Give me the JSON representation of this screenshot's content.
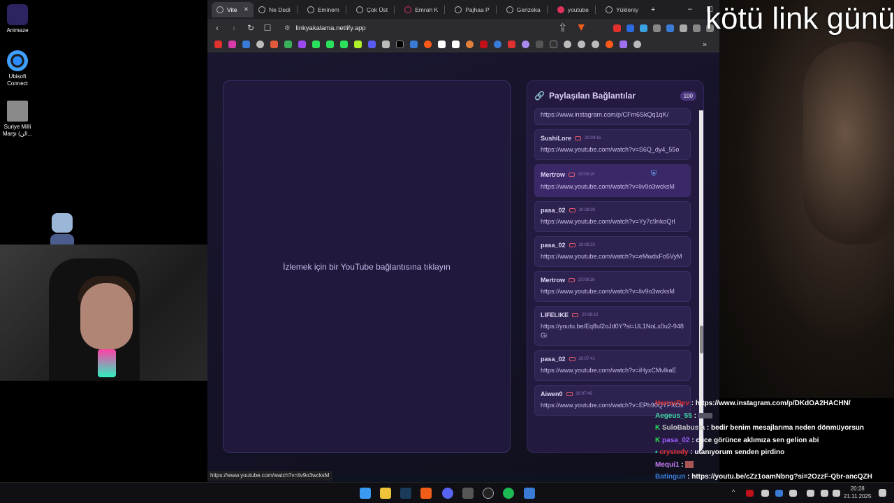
{
  "overlay_title": "kötü link günü",
  "desktop": {
    "icons": [
      {
        "label": "Animaze"
      },
      {
        "label": "Ubisoft Connect"
      },
      {
        "label": "Suriye Milli Marşı (الن..."
      }
    ]
  },
  "browser": {
    "tabs": [
      {
        "label": "Vite",
        "icon": "globe-icon",
        "active": true
      },
      {
        "label": "Ne Dedi",
        "icon": "globe-icon"
      },
      {
        "label": "Eminem",
        "icon": "globe-icon"
      },
      {
        "label": "Çok Üst",
        "icon": "globe-icon"
      },
      {
        "label": "Emrah K",
        "icon": "globe-icon"
      },
      {
        "label": "Pajhaa P",
        "icon": "globe-icon"
      },
      {
        "label": "Gerizeka",
        "icon": "globe-icon"
      },
      {
        "label": "youtube",
        "icon": "globe-icon"
      },
      {
        "label": "Yükleniy",
        "icon": "globe-icon"
      }
    ],
    "url": "linkyakalama.netlify.app",
    "status_url": "https://www.youtube.com/watch?v=liv9o3wcksM"
  },
  "page": {
    "player_placeholder": "İzlemek için bir YouTube bağlantısına tıklayın",
    "panel_title": "Paylaşılan Bağlantılar",
    "panel_count": "100",
    "links": [
      {
        "user": "",
        "time": "",
        "url": "https://www.instagram.com/p/CFm6SkQq1qK/"
      },
      {
        "user": "SushiLore",
        "time": "20:09:16",
        "url": "https://www.youtube.com/watch?v=S6Q_dy4_55o"
      },
      {
        "user": "Mertrow",
        "time": "20:09:10",
        "url": "https://www.youtube.com/watch?v=liv9o3wcksM"
      },
      {
        "user": "pasa_02",
        "time": "20:08:39",
        "url": "https://www.youtube.com/watch?v=Yy7c9nkoQrI"
      },
      {
        "user": "pasa_02",
        "time": "20:08:23",
        "url": "https://www.youtube.com/watch?v=eMwdxFo5VyM"
      },
      {
        "user": "Mertrow",
        "time": "20:08:16",
        "url": "https://www.youtube.com/watch?v=liv9o3wcksM"
      },
      {
        "user": "LIFELIKE",
        "time": "20:08:10",
        "url": "https://youtu.be/Eq8ul2oJd0Y?si=UL1NoLx0u2-948Gi"
      },
      {
        "user": "pasa_02",
        "time": "20:07:41",
        "url": "https://www.youtube.com/watch?v=iHyxCMvlkaE"
      },
      {
        "user": "Aiwen0",
        "time": "20:07:40",
        "url": "https://www.youtube.com/watch?v=EPh90QYPXOs"
      }
    ]
  },
  "chat": [
    {
      "user": "HerrorDev",
      "color": "#e0312f",
      "text": "https://www.instagram.com/p/DKdOA2HACHN/"
    },
    {
      "user": "Aegeus_55",
      "color": "#3fd6a2",
      "text": ""
    },
    {
      "user": "SuloBabusta",
      "color": "#c8c8c8",
      "text": "bedir benim mesajlarıma neden dönmüyorsun"
    },
    {
      "user": "pasa_02",
      "color": "#9a5cff",
      "text": "cüce görünce aklımıza sen gelion abi"
    },
    {
      "user": "crystedy",
      "color": "#e0312f",
      "text": "utanıyorum senden pirdino"
    },
    {
      "user": "Mequi1",
      "color": "#c27bf0",
      "text": ""
    },
    {
      "user": "Batingun",
      "color": "#3a7bd5",
      "text": "https://youtu.be/cZz1oamNbng?si=2OzzF-Qbr-ancQZH"
    }
  ],
  "taskbar": {
    "time": "20:28",
    "date": "21.11.2025"
  }
}
